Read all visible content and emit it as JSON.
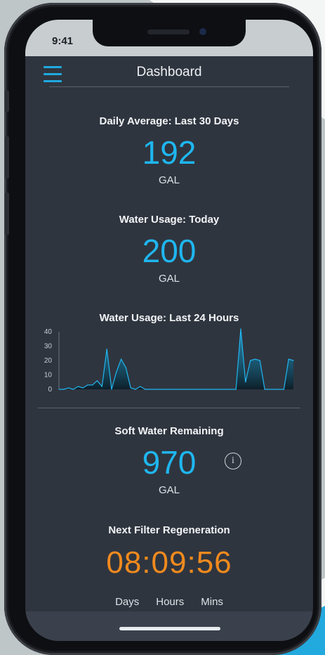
{
  "status_bar": {
    "time": "9:41"
  },
  "header": {
    "title": "Dashboard"
  },
  "daily_average": {
    "title": "Daily Average: Last 30 Days",
    "value": "192",
    "unit": "GAL"
  },
  "usage_today": {
    "title": "Water Usage: Today",
    "value": "200",
    "unit": "GAL"
  },
  "usage_24h": {
    "title": "Water Usage: Last 24 Hours"
  },
  "soft_water": {
    "title": "Soft Water Remaining",
    "value": "970",
    "unit": "GAL"
  },
  "regeneration": {
    "title": "Next Filter Regeneration",
    "timer": "08:09:56",
    "labels": [
      "Days",
      "Hours",
      "Mins"
    ]
  },
  "colors": {
    "accent": "#1fb6ef",
    "timer": "#f08a1e",
    "background": "#2f353f"
  },
  "chart_data": {
    "type": "area",
    "title": "Water Usage: Last 24 Hours",
    "xlabel": "",
    "ylabel": "",
    "ylim": [
      0,
      40
    ],
    "yticks": [
      "0",
      "10",
      "20",
      "30",
      "40"
    ],
    "x": [
      0,
      1,
      2,
      3,
      4,
      5,
      6,
      7,
      8,
      9,
      10,
      11,
      12,
      13,
      14,
      15,
      16,
      17,
      18,
      19,
      20,
      21,
      22,
      23,
      24,
      25,
      26,
      27,
      28,
      29,
      30,
      31,
      32,
      33,
      34,
      35,
      36,
      37,
      38,
      39,
      40,
      41,
      42,
      43,
      44,
      45,
      46,
      47
    ],
    "values": [
      0,
      0,
      1,
      0,
      2,
      1,
      3,
      3,
      6,
      2,
      28,
      0,
      12,
      21,
      15,
      1,
      0,
      2,
      0,
      0,
      0,
      0,
      0,
      0,
      0,
      0,
      0,
      0,
      0,
      0,
      0,
      0,
      0,
      0,
      0,
      0,
      0,
      0,
      42,
      5,
      20,
      21,
      20,
      0,
      0,
      0,
      0,
      0
    ],
    "tail": [
      21,
      20
    ]
  }
}
